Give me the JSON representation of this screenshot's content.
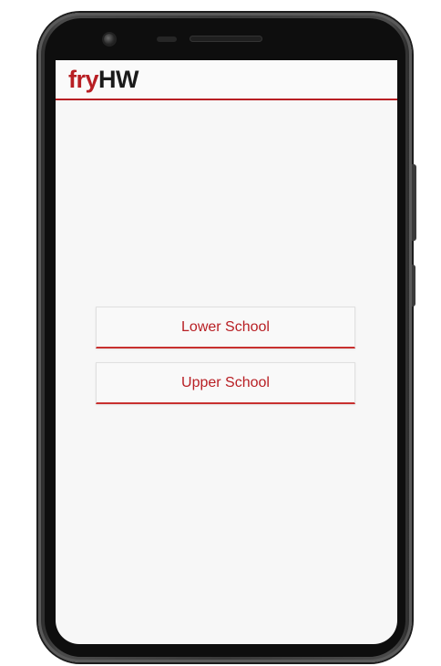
{
  "app": {
    "logo": {
      "part_a": "fry",
      "part_b": "HW"
    }
  },
  "menu": {
    "items": [
      {
        "label": "Lower School"
      },
      {
        "label": "Upper School"
      }
    ]
  },
  "colors": {
    "brand_red": "#b81f24",
    "brand_dark": "#1a1a1a",
    "screen_bg": "#f7f7f7"
  }
}
